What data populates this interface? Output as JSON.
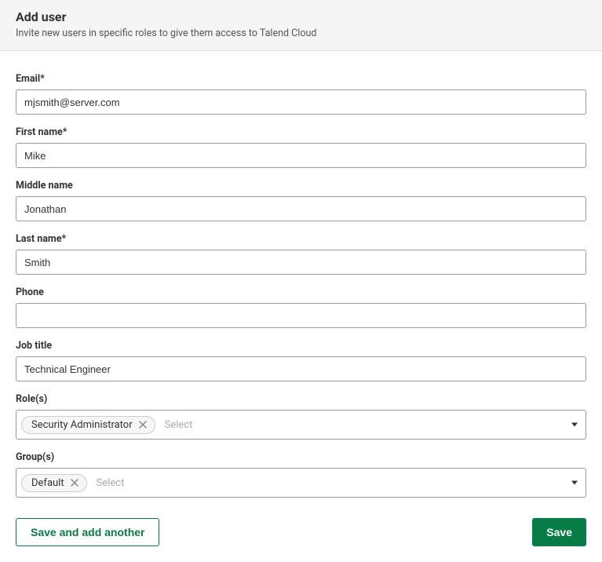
{
  "header": {
    "title": "Add user",
    "subtitle": "Invite new users in specific roles to give them access to Talend Cloud"
  },
  "form": {
    "email": {
      "label": "Email*",
      "value": "mjsmith@server.com"
    },
    "first_name": {
      "label": "First name*",
      "value": "Mike"
    },
    "middle_name": {
      "label": "Middle name",
      "value": "Jonathan"
    },
    "last_name": {
      "label": "Last name*",
      "value": "Smith"
    },
    "phone": {
      "label": "Phone",
      "value": ""
    },
    "job_title": {
      "label": "Job title",
      "value": "Technical Engineer"
    },
    "roles": {
      "label": "Role(s)",
      "chips": [
        "Security Administrator"
      ],
      "placeholder": "Select"
    },
    "groups": {
      "label": "Group(s)",
      "chips": [
        "Default"
      ],
      "placeholder": "Select"
    }
  },
  "buttons": {
    "save_add_another": "Save and add another",
    "save": "Save"
  }
}
